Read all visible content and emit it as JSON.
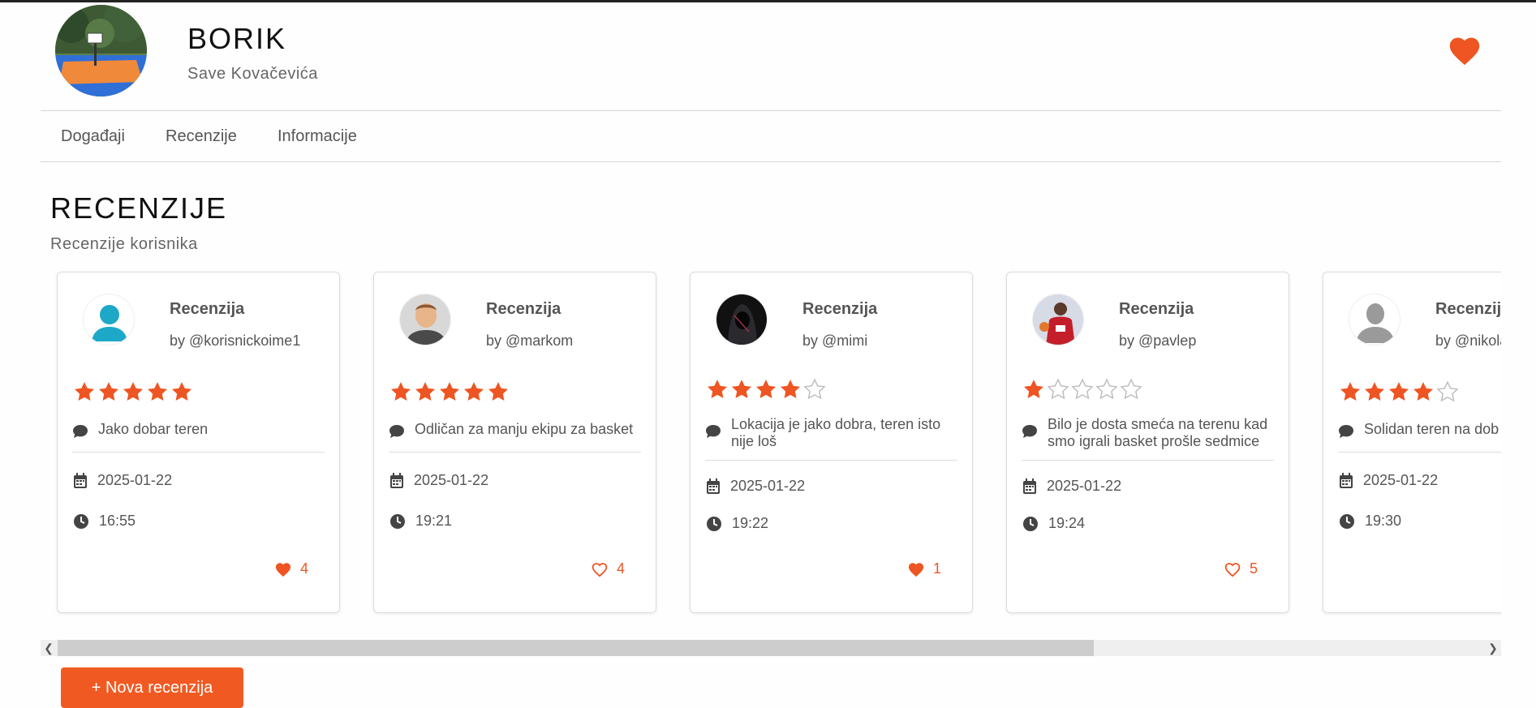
{
  "court": {
    "name": "BORIK",
    "address": "Save Kovačevića"
  },
  "tabs": [
    {
      "label": "Događaji"
    },
    {
      "label": "Recenzije"
    },
    {
      "label": "Informacije"
    }
  ],
  "section": {
    "title": "RECENZIJE",
    "subtitle": "Recenzije korisnika"
  },
  "reviews": [
    {
      "title": "Recenzija",
      "by": "by @korisnickoime1",
      "rating": 5,
      "comment": "Jako dobar teren",
      "date": "2025-01-22",
      "time": "16:55",
      "likes": "4",
      "liked": true
    },
    {
      "title": "Recenzija",
      "by": "by @markom",
      "rating": 5,
      "comment": "Odličan za manju ekipu za basket",
      "date": "2025-01-22",
      "time": "19:21",
      "likes": "4",
      "liked": false
    },
    {
      "title": "Recenzija",
      "by": "by @mimi",
      "rating": 4,
      "comment": "Lokacija je jako dobra, teren isto nije loš",
      "date": "2025-01-22",
      "time": "19:22",
      "likes": "1",
      "liked": true
    },
    {
      "title": "Recenzija",
      "by": "by @pavlep",
      "rating": 1,
      "comment": "Bilo je dosta smeća na terenu kad smo igrali basket prošle sedmice",
      "date": "2025-01-22",
      "time": "19:24",
      "likes": "5",
      "liked": false
    },
    {
      "title": "Recenzija",
      "by": "by @nikola",
      "rating": 4,
      "comment": "Solidan teren na dob",
      "date": "2025-01-22",
      "time": "19:30",
      "likes": "",
      "liked": false
    }
  ],
  "actions": {
    "new_review": "+ Nova recenzija"
  },
  "colors": {
    "accent": "#ee5522",
    "star_empty": "#bbbbbb"
  }
}
